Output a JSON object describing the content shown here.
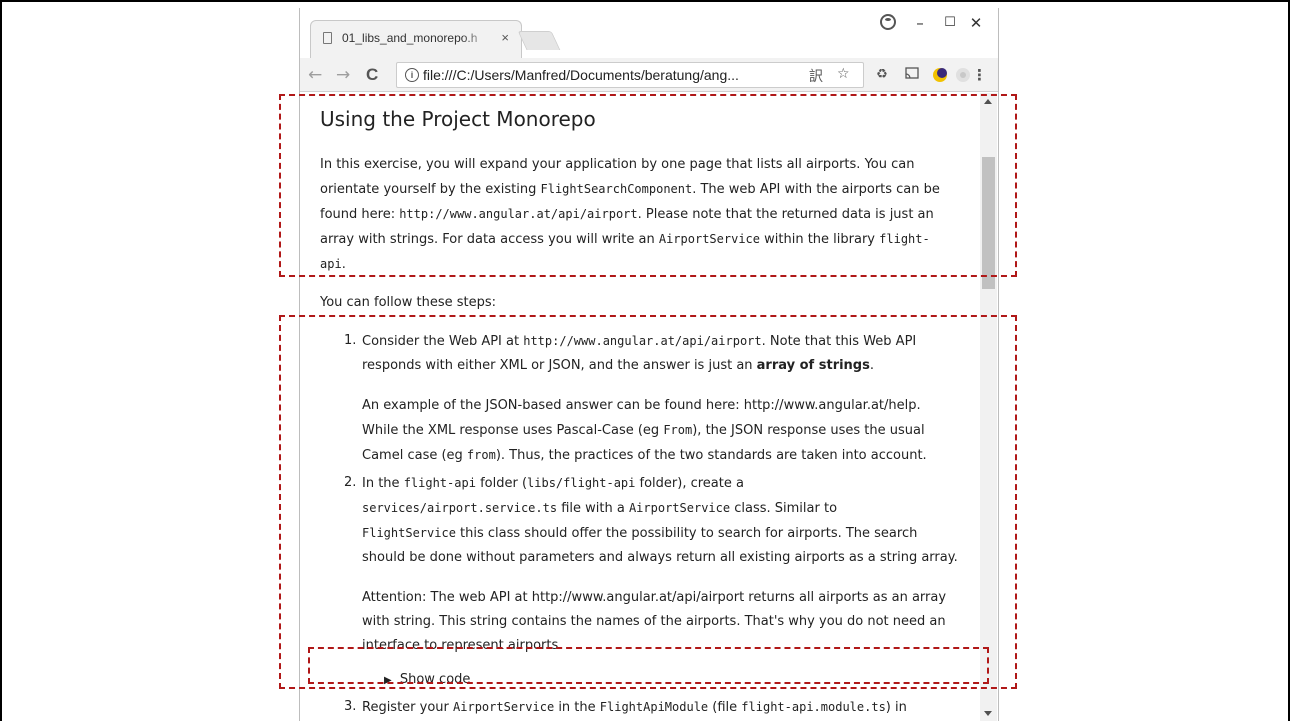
{
  "browser": {
    "tab_title": "01_libs_and_monorepo.h",
    "tab_close": "×",
    "url": "file:///C:/Users/Manfred/Documents/beratung/ang...",
    "window_controls": {
      "minimize": "–",
      "maximize": "☐",
      "close": "✕"
    },
    "nav": {
      "back": "←",
      "forward": "→",
      "reload": "C"
    },
    "info_glyph": "i",
    "icons": [
      "translate-icon",
      "bookmark-star-icon",
      "recycle-extension-icon",
      "cast-icon",
      "moon-extension-icon",
      "gray-extension-icon",
      "kebab-menu-icon"
    ]
  },
  "page": {
    "title": "Using the Project Monorepo",
    "intro": {
      "l1": "In this exercise, you will expand your application by one page that lists all airports. You can",
      "l2a": "orientate yourself by the existing ",
      "l2code": "FlightSearchComponent",
      "l2b": ". The web API with the airports can be",
      "l3a": "found here: ",
      "l3code": "http://www.angular.at/api/airport",
      "l3b": ". Please note that the returned data is just an",
      "l4a": "array with strings. For data access you will write an ",
      "l4code1": "AirportService",
      "l4b": " within the library ",
      "l4code2": "flight-",
      "l5code": "api",
      "l5b": "."
    },
    "follow": "You can follow these steps:",
    "step1": {
      "num": "1.",
      "l1a": "Consider the Web API at ",
      "l1code": "http://www.angular.at/api/airport",
      "l1b": ". Note that this Web API",
      "l2a": "responds with either XML or JSON, and the answer is just an ",
      "l2bold": "array of strings",
      "l2b": ".",
      "p2l1": "An example of the JSON-based answer can be found here: http://www.angular.at/help.",
      "p2l2a": "While the XML response uses Pascal-Case (eg ",
      "p2l2code": "From",
      "p2l2b": "), the JSON response uses the usual",
      "p2l3a": "Camel case (eg ",
      "p2l3code": "from",
      "p2l3b": "). Thus, the practices of the two standards are taken into account."
    },
    "step2": {
      "num": "2.",
      "l1a": "In the ",
      "l1code1": "flight-api",
      "l1b": " folder (",
      "l1code2": "libs/flight-api",
      "l1c": " folder), create a",
      "l2code1": "services/airport.service.ts",
      "l2b": " file with a ",
      "l2code2": "AirportService",
      "l2c": " class. Similar to",
      "l3code": "FlightService",
      "l3b": " this class should offer the possibility to search for airports. The search",
      "l4": "should be done without parameters and always return all existing airports as a string array.",
      "p2l1": "Attention: The web API at http://www.angular.at/api/airport returns all airports as an array",
      "p2l2": "with string. This string contains the names of the airports. That's why you do not need an",
      "p2l3": "interface to represent airports.",
      "show_code": "Show code",
      "triangle": "▶"
    },
    "step3": {
      "num": "3.",
      "l1a": "Register your ",
      "l1code1": "AirportService",
      "l1b": " in the ",
      "l1code2": "FlightApiModule",
      "l1c": " (file ",
      "l1code3": "flight-api.module.ts",
      "l1d": ") in"
    }
  },
  "colors": {
    "highlight": "#b01818",
    "tab_bg": "#f2f2f2",
    "toolbar_bg": "#f2f2f2"
  }
}
